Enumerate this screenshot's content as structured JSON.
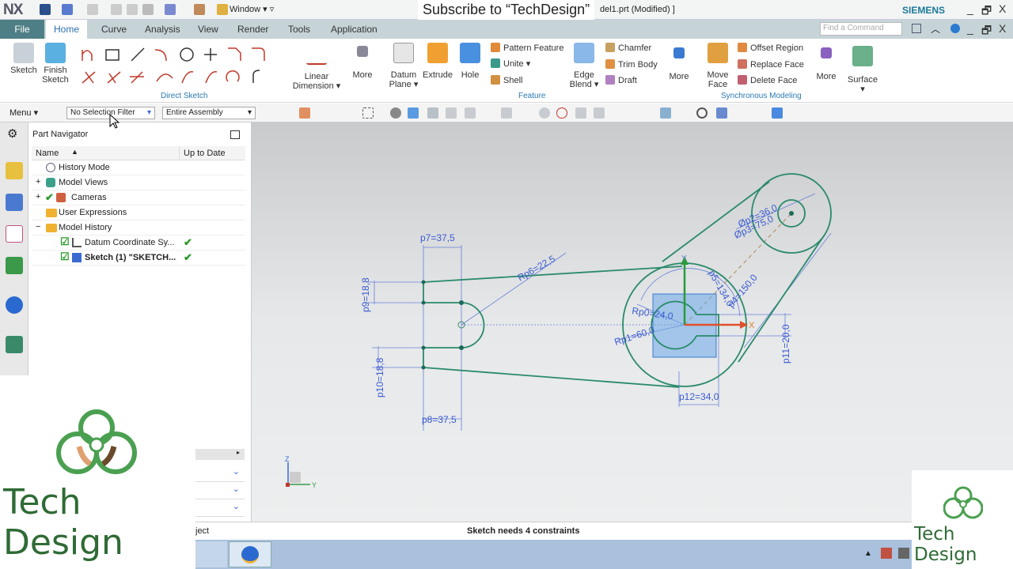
{
  "titlebar": {
    "app": "NX",
    "window_menu": "Window ▾ ▿",
    "overlay": "Subscribe to “TechDesign”",
    "filename": "del1.prt (Modified) ]",
    "brand": "SIEMENS",
    "minimize": "_",
    "restore": "🗗",
    "close": "X"
  },
  "tabs": [
    "File",
    "Home",
    "Curve",
    "Analysis",
    "View",
    "Render",
    "Tools",
    "Application"
  ],
  "find_placeholder": "Find a Command",
  "ribbon": {
    "sketch": "Sketch",
    "finish_sketch": "Finish Sketch",
    "direct_sketch_group": "Direct Sketch",
    "linear_dimension": "Linear Dimension ▾",
    "more": "More",
    "datum_plane": "Datum Plane ▾",
    "extrude": "Extrude",
    "hole": "Hole",
    "pattern_feature": "Pattern Feature",
    "unite": "Unite ▾",
    "shell": "Shell",
    "edge_blend": "Edge Blend ▾",
    "chamfer": "Chamfer",
    "trim_body": "Trim Body",
    "draft": "Draft",
    "feature_group": "Feature",
    "move_face": "Move Face",
    "offset_region": "Offset Region",
    "replace_face": "Replace Face",
    "delete_face": "Delete Face",
    "sync_group": "Synchronous Modeling",
    "surface": "Surface ▾"
  },
  "toolbar": {
    "menu": "Menu ▾",
    "selection_filter": "No Selection Filter",
    "assembly_scope": "Entire Assembly"
  },
  "navigator": {
    "title": "Part Navigator",
    "col_name": "Name",
    "col_uptodate": "Up to Date",
    "rows": [
      {
        "label": "History Mode",
        "expander": "",
        "check": "",
        "uptodate": ""
      },
      {
        "label": "Model Views",
        "expander": "+",
        "check": "",
        "uptodate": ""
      },
      {
        "label": "Cameras",
        "expander": "+",
        "check": "✔",
        "uptodate": ""
      },
      {
        "label": "User Expressions",
        "expander": "",
        "check": "",
        "uptodate": ""
      },
      {
        "label": "Model History",
        "expander": "−",
        "check": "",
        "uptodate": ""
      },
      {
        "label": "Datum Coordinate Sy...",
        "expander": "",
        "check": "☑",
        "uptodate": "✔"
      },
      {
        "label": "Sketch (1) \"SKETCH...",
        "expander": "",
        "check": "☑",
        "uptodate": "✔"
      }
    ]
  },
  "sketch": {
    "dims": {
      "p7": "p7=37,5",
      "p8": "p8=37,5",
      "p9": "p9=18,8",
      "p10": "p10=18,8",
      "p6": "Rp6=22,5",
      "p0": "Rp0=24,0",
      "p1": "Rp1=60,0",
      "p5": "p5=134,0",
      "p4": "p4=150,0",
      "p2": "Øp2=36,0",
      "p3": "Øp3=75,0",
      "p11": "p11=20,0",
      "p12": "p12=34,0"
    },
    "axis_x": "X",
    "axis_y": "Y",
    "triad_z": "Z",
    "triad_y": "Y",
    "colors": {
      "geometry": "#2a8a6a",
      "dimension": "#3a5ad0",
      "x_axis": "#e0502a",
      "y_axis": "#2a9a3a"
    }
  },
  "status": {
    "left": "ject",
    "center": "Sketch needs 4 constraints"
  },
  "logo": {
    "text": "Tech Design"
  }
}
